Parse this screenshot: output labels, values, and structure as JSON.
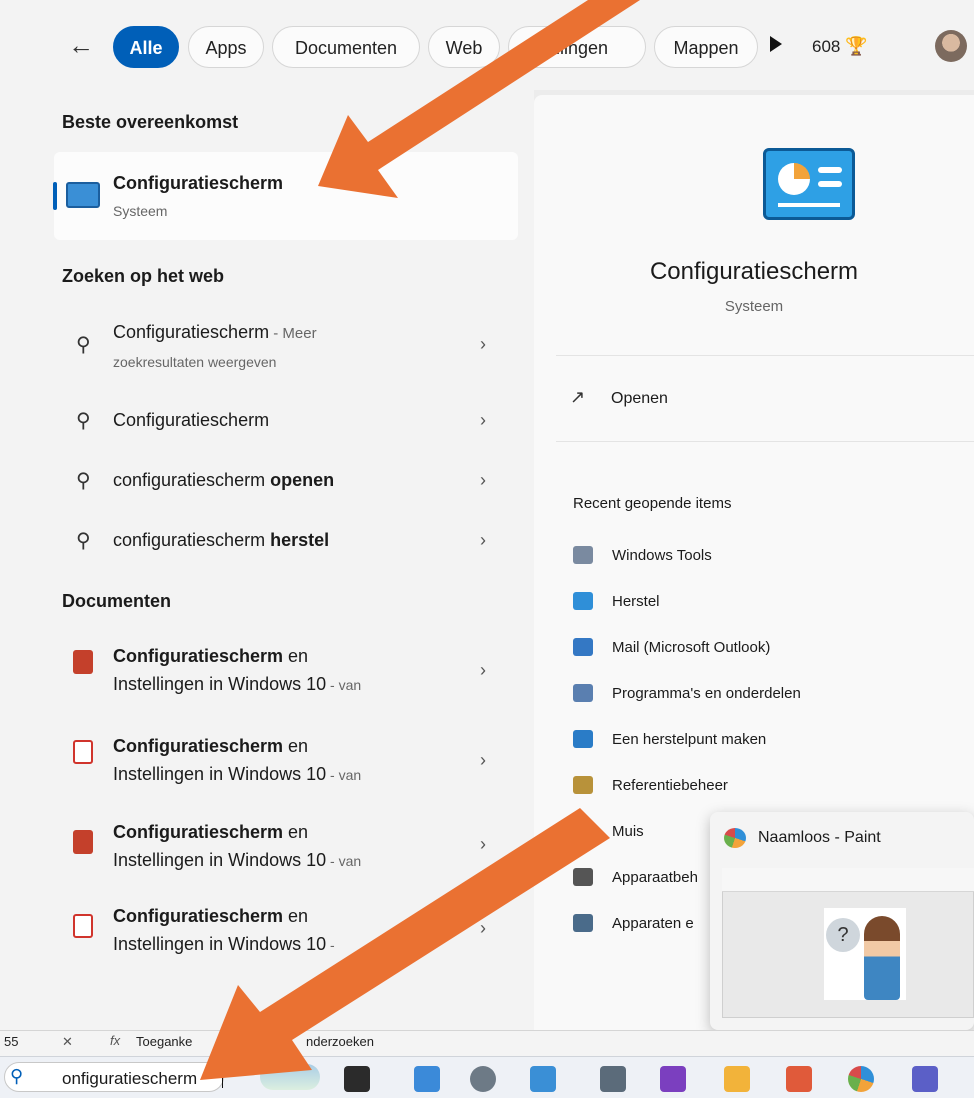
{
  "filter_bar": {
    "back_label": "←",
    "tabs": [
      {
        "label": "Alle",
        "active": true
      },
      {
        "label": "Apps",
        "active": false
      },
      {
        "label": "Documenten",
        "active": false
      },
      {
        "label": "Web",
        "active": false
      },
      {
        "label": "ellingen",
        "active": false
      },
      {
        "label": "Mappen",
        "active": false
      }
    ],
    "points": "608",
    "points_icon": "trophy-icon"
  },
  "left": {
    "best_heading": "Beste overeenkomst",
    "best": {
      "title": "Configuratiescherm",
      "subtitle": "Systeem",
      "icon": "control-panel-icon"
    },
    "web_heading": "Zoeken op het web",
    "web_items": [
      {
        "main": "Configuratiescherm",
        "suffix": " - Meer",
        "sub": "zoekresultaten weergeven"
      },
      {
        "main": "Configuratiescherm",
        "bold": ""
      },
      {
        "main": "configuratiescherm ",
        "bold": "openen"
      },
      {
        "main": "configuratiescherm ",
        "bold": "herstel"
      }
    ],
    "docs_heading": "Documenten",
    "docs": [
      {
        "title_bold": "Configuratiescherm",
        "title_rest": " en",
        "line2": "Instellingen in Windows 10",
        "suffix": " - van",
        "icon": "ppt"
      },
      {
        "title_bold": "Configuratiescherm",
        "title_rest": " en",
        "line2": "Instellingen in Windows 10",
        "suffix": " - van",
        "icon": "pdf"
      },
      {
        "title_bold": "Configuratiescherm",
        "title_rest": " en",
        "line2": "Instellingen in Windows 10",
        "suffix": " - van",
        "icon": "ppt"
      },
      {
        "title_bold": "Configuratiescherm",
        "title_rest": " en",
        "line2": "Instellingen in Windows 10",
        "suffix": " - ",
        "icon": "pdf"
      }
    ]
  },
  "right": {
    "title": "Configuratiescherm",
    "subtitle": "Systeem",
    "open_label": "Openen",
    "recent_heading": "Recent geopende items",
    "recent_items": [
      {
        "label": "Windows Tools",
        "icon": "windows-tools-icon",
        "color": "#7a8aa0"
      },
      {
        "label": "Herstel",
        "icon": "recovery-icon",
        "color": "#2f8fd8"
      },
      {
        "label": "Mail (Microsoft Outlook)",
        "icon": "mail-icon",
        "color": "#3478c4"
      },
      {
        "label": "Programma's en onderdelen",
        "icon": "programs-icon",
        "color": "#5a7fb0"
      },
      {
        "label": "Een herstelpunt maken",
        "icon": "restore-point-icon",
        "color": "#2a7cc7"
      },
      {
        "label": "Referentiebeheer",
        "icon": "credential-icon",
        "color": "#b8923a"
      },
      {
        "label": "Muis",
        "icon": "mouse-icon",
        "color": "#6f6f6f"
      },
      {
        "label": "Apparaatbeh",
        "icon": "device-manager-icon",
        "color": "#555555"
      },
      {
        "label": "Apparaten e",
        "icon": "devices-icon",
        "color": "#4a6b8a"
      }
    ]
  },
  "paint_preview": {
    "title": "Naamloos - Paint",
    "question_mark": "?"
  },
  "formula_bar": {
    "cell_ref": "55",
    "text": "Toeganke",
    "text2": "nderzoeken"
  },
  "taskbar": {
    "search_value": "onfiguratiescherm"
  },
  "colors": {
    "accent": "#005fb8",
    "arrow": "#ea7132"
  }
}
